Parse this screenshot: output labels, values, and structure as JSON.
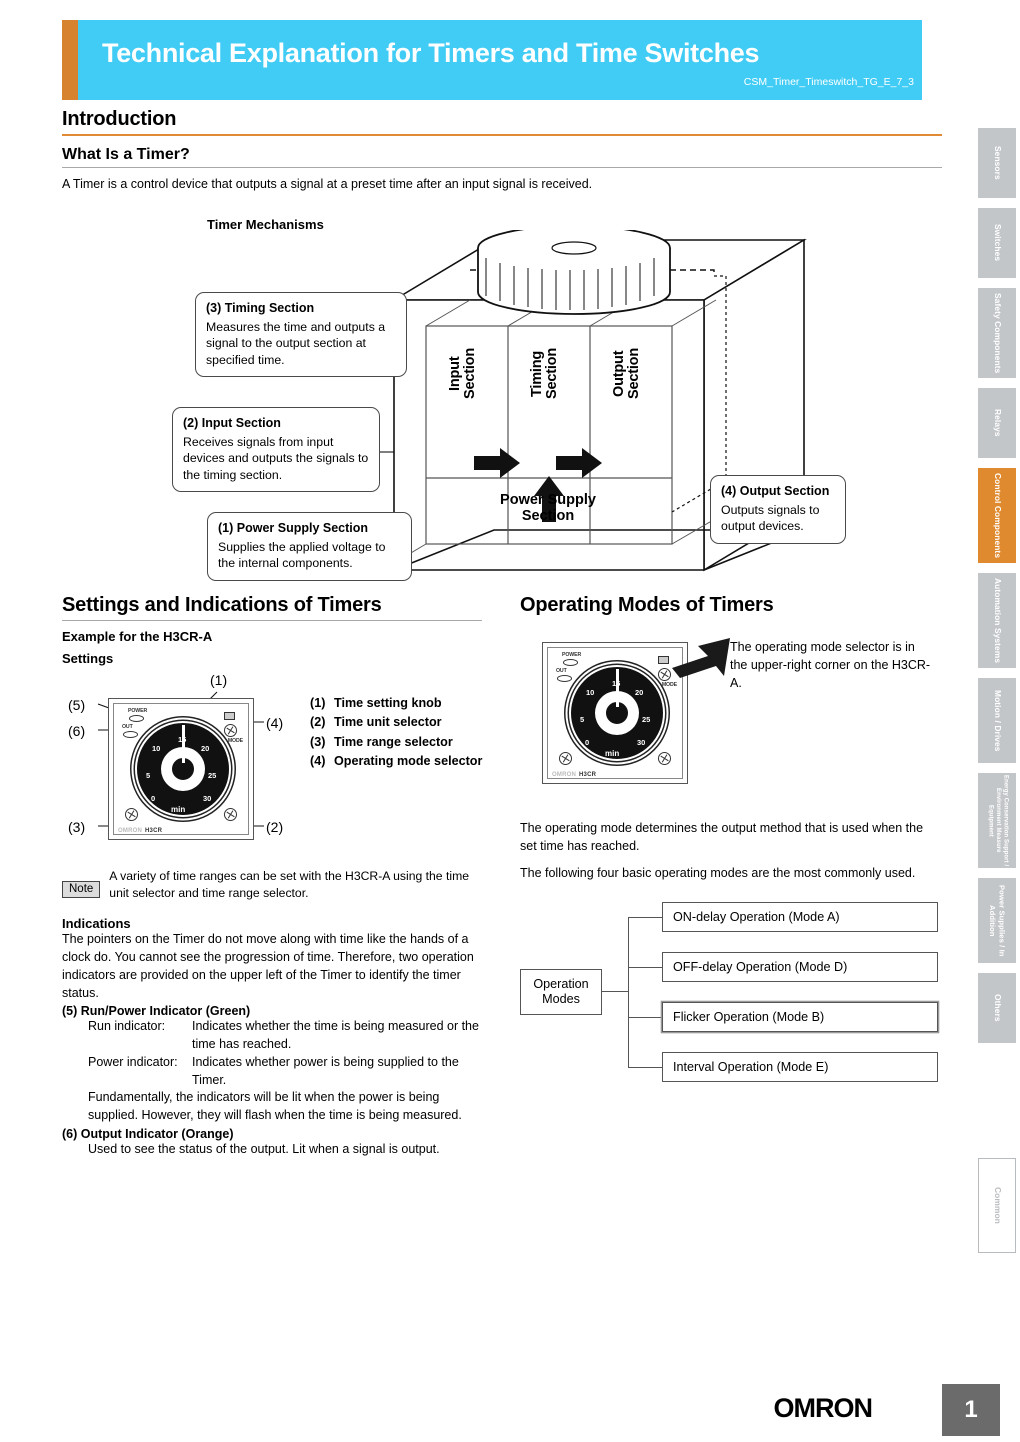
{
  "header": {
    "title": "Technical Explanation for Timers and Time Switches",
    "code": "CSM_Timer_Timeswitch_TG_E_7_3",
    "accent_orange": "#d6822f",
    "accent_cyan": "#40ccf5"
  },
  "intro": {
    "heading": "Introduction",
    "subheading": "What Is a Timer?",
    "paragraph": "A Timer is a control device that outputs a signal at a preset time after an input signal is received.",
    "diagram_title": "Timer Mechanisms"
  },
  "mechanism": {
    "callouts": [
      {
        "title": "(3) Timing Section",
        "text": "Measures the time and outputs a signal to the output section at specified time."
      },
      {
        "title": "(2) Input Section",
        "text": "Receives signals from input devices and outputs the signals to the timing section."
      },
      {
        "title": "(1) Power Supply Section",
        "text": "Supplies the applied voltage to the internal components."
      },
      {
        "title": "(4) Output Section",
        "text": "Outputs signals to output devices."
      }
    ],
    "box_labels": {
      "input": "Input\nSection",
      "timing": "Timing\nSection",
      "output": "Output\nSection",
      "power": "Power Supply\nSection"
    }
  },
  "settings": {
    "heading": "Settings and Indications of Timers",
    "example": "Example for the H3CR-A",
    "settings_label": "Settings",
    "callout_numbers": [
      "(1)",
      "(2)",
      "(3)",
      "(4)",
      "(5)",
      "(6)"
    ],
    "legend": [
      {
        "n": "(1)",
        "label": "Time setting knob"
      },
      {
        "n": "(2)",
        "label": "Time unit selector"
      },
      {
        "n": "(3)",
        "label": "Time range selector"
      },
      {
        "n": "(4)",
        "label": "Operating mode selector"
      }
    ],
    "note_badge": "Note",
    "note_text": "A variety of time ranges can be set with the H3CR-A using the time unit selector and time range selector.",
    "indications_heading": "Indications",
    "indications_paragraph": "The pointers on the Timer do not move along with time like the hands of a clock do. You cannot see the progression of time. Therefore, two operation indicators are provided on the upper left of the Timer to identify the timer status.",
    "item5_title": "(5) Run/Power Indicator (Green)",
    "item5_run_key": "Run indicator:",
    "item5_run_val": "Indicates whether the time is being measured or the time has reached.",
    "item5_power_key": "Power indicator:",
    "item5_power_val": "Indicates whether power is being supplied to the Timer.",
    "item5_extra": "Fundamentally, the indicators will be lit when the power is being supplied. However, they will flash when the time is being measured.",
    "item6_title": "(6) Output Indicator (Orange)",
    "item6_text": "Used to see the status of the output. Lit when a signal is output."
  },
  "device": {
    "power_label": "POWER",
    "out_label": "OUT",
    "mode_label": "MODE",
    "unit_label": "min",
    "model_label": "H3CR",
    "brand_label": "OMRON",
    "dial_numbers": [
      "0",
      "5",
      "10",
      "15",
      "20",
      "25",
      "30"
    ]
  },
  "operating": {
    "heading": "Operating Modes of Timers",
    "selector_note": "The operating mode selector is in the upper-right corner on the H3CR-A.",
    "paragraph1": "The operating mode determines the output method that is used when the set time has reached.",
    "paragraph2": "The following four basic operating modes are the most commonly used.",
    "tree_root": "Operation\nModes",
    "tree_nodes": [
      "ON-delay Operation (Mode A)",
      "OFF-delay Operation (Mode D)",
      "Flicker Operation (Mode B)",
      "Interval Operation (Mode E)"
    ]
  },
  "sidebar": {
    "tabs": [
      {
        "label": "Sensors",
        "active": false,
        "outline": false
      },
      {
        "label": "Switches",
        "active": false,
        "outline": false
      },
      {
        "label": "Safety Components",
        "active": false,
        "outline": false
      },
      {
        "label": "Relays",
        "active": false,
        "outline": false
      },
      {
        "label": "Control Components",
        "active": true,
        "outline": false
      },
      {
        "label": "Automation Systems",
        "active": false,
        "outline": false
      },
      {
        "label": "Motion / Drives",
        "active": false,
        "outline": false
      },
      {
        "label": "Energy Conservation Support / Environment Measure Equipment",
        "active": false,
        "outline": false
      },
      {
        "label": "Power Supplies / In Addition",
        "active": false,
        "outline": false
      },
      {
        "label": "Others",
        "active": false,
        "outline": false
      },
      {
        "label": "Common",
        "active": false,
        "outline": true
      }
    ]
  },
  "footer": {
    "brand": "OMRON",
    "page_number": "1"
  }
}
